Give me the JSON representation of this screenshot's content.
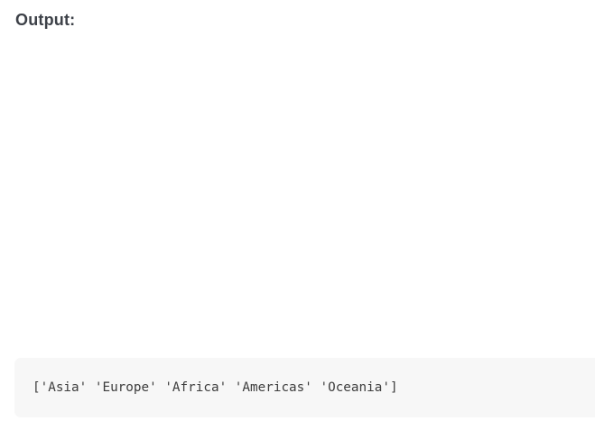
{
  "section": {
    "heading": "Output:"
  },
  "output_block": {
    "code": "['Asia' 'Europe' 'Africa' 'Americas' 'Oceania']"
  }
}
